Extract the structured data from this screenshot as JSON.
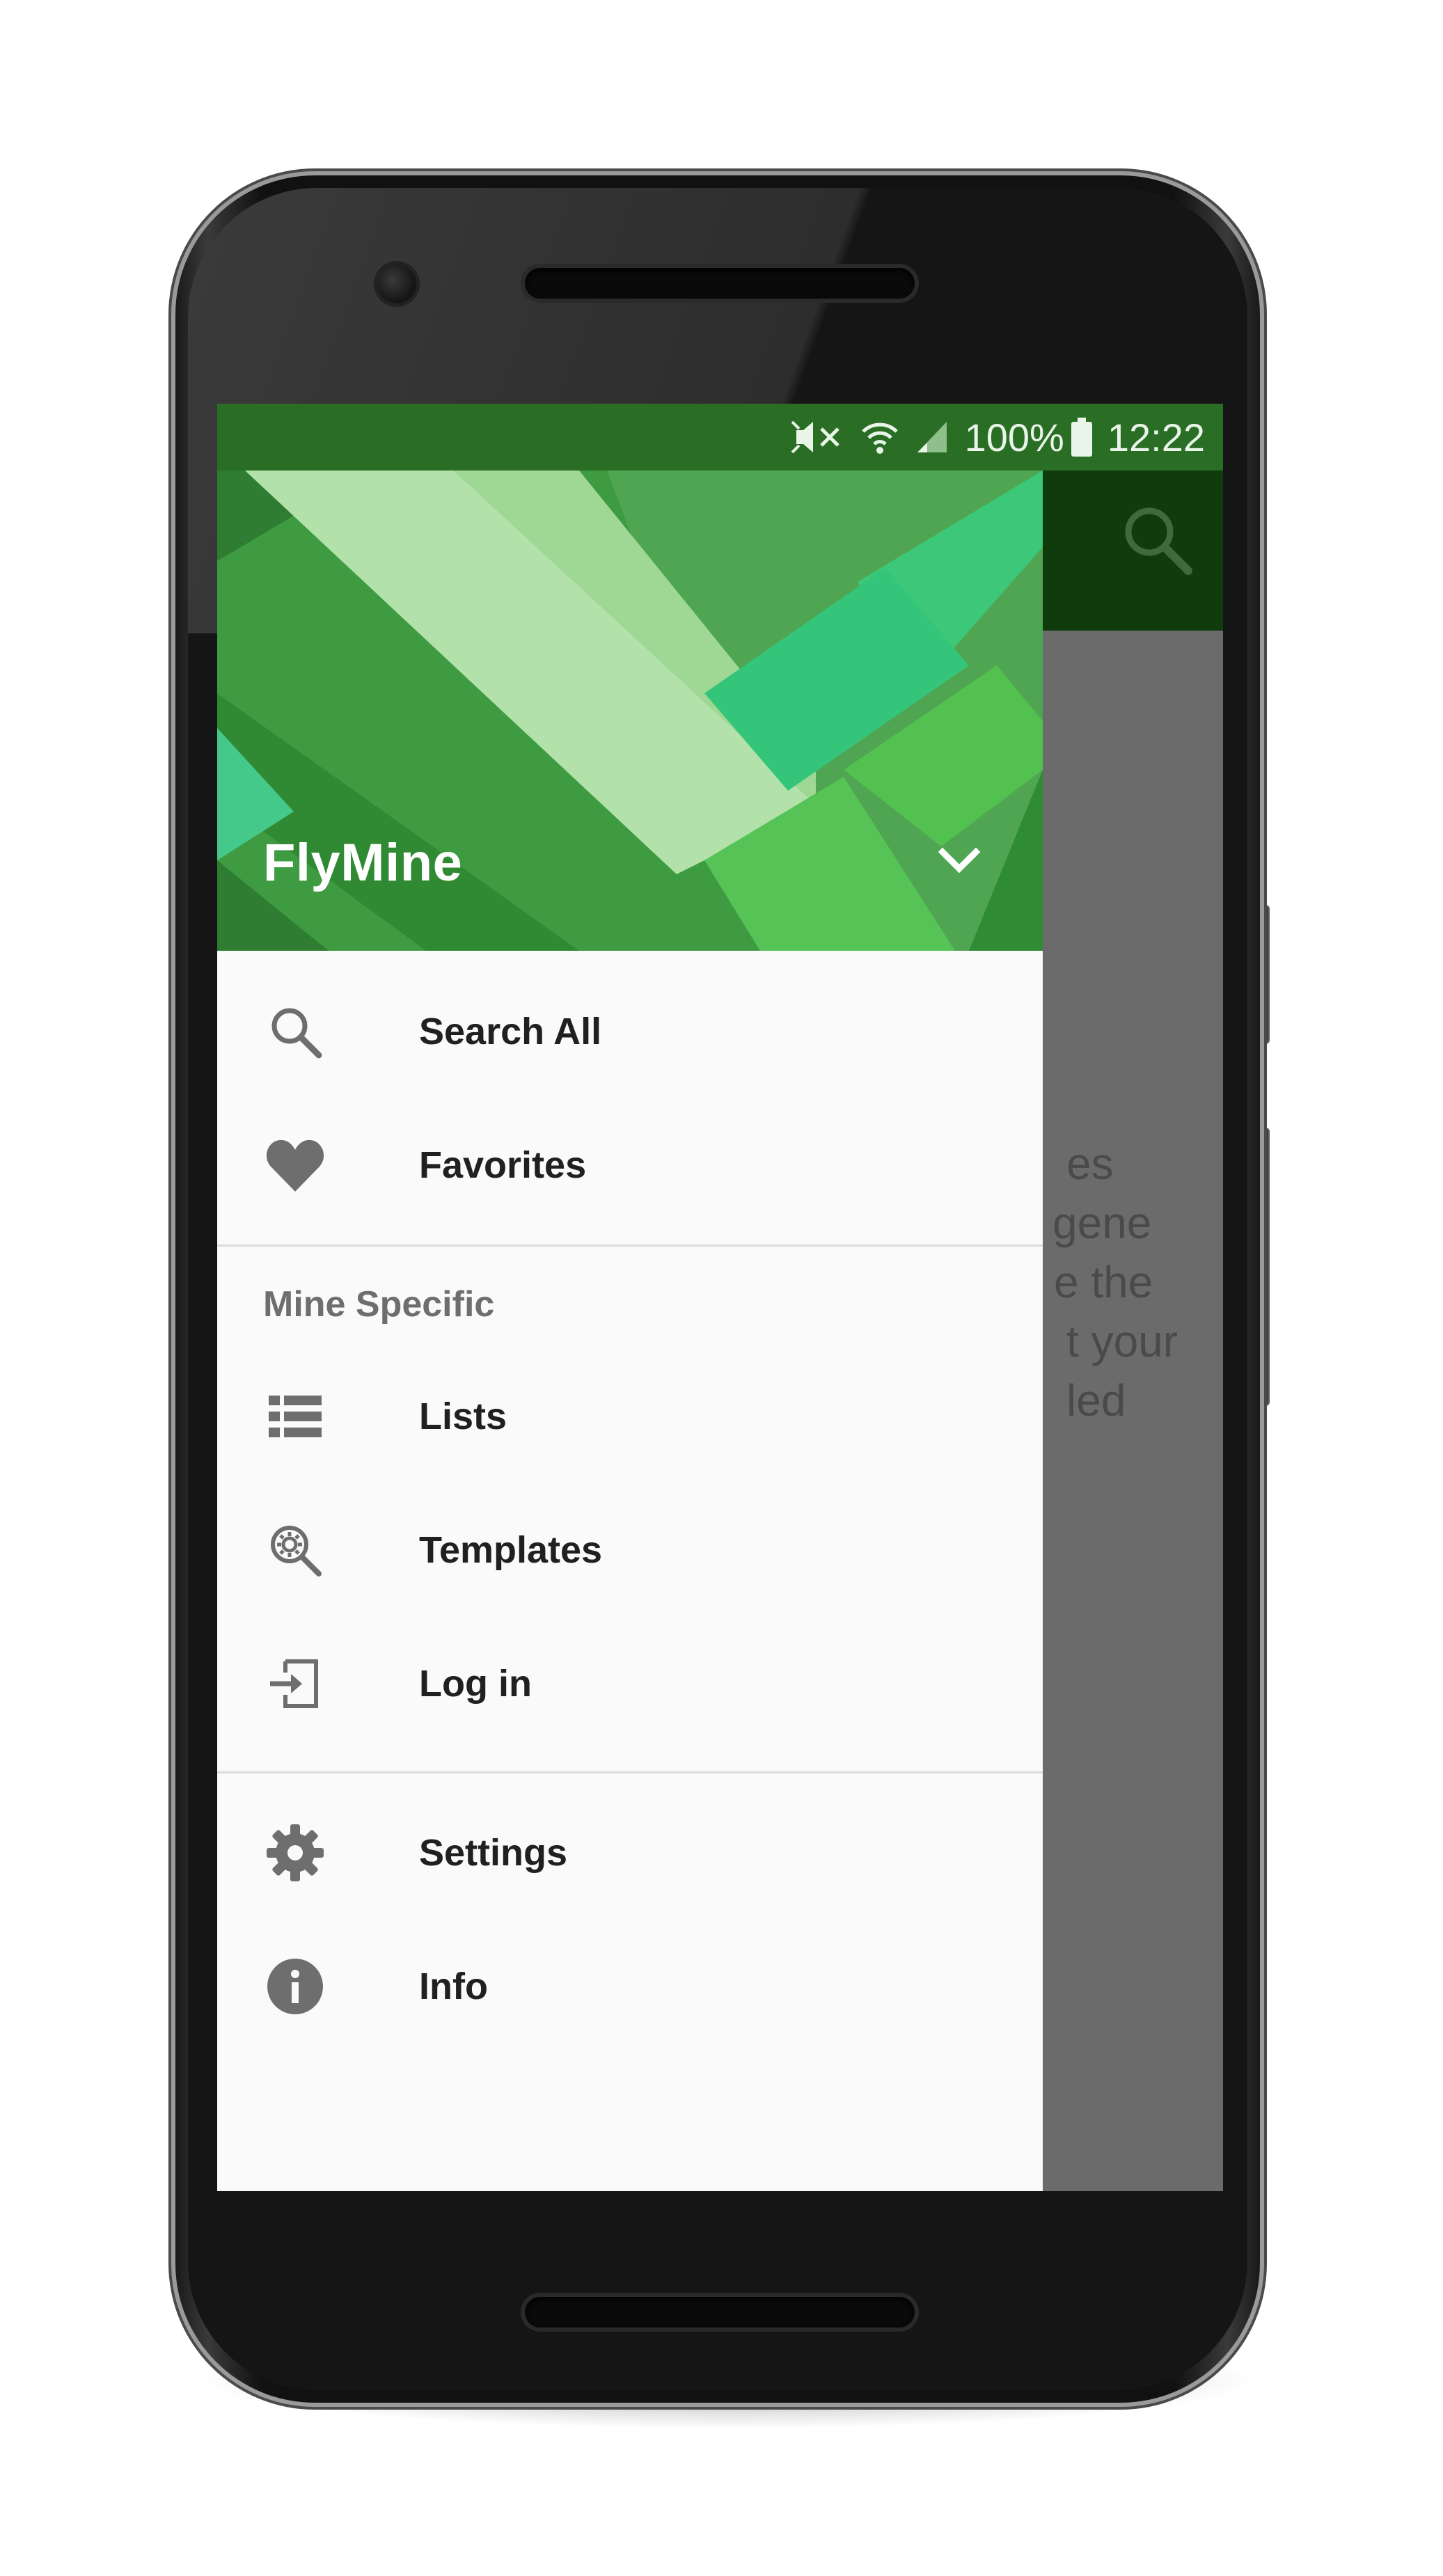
{
  "status_bar": {
    "battery": "100%",
    "time": "12:22",
    "icons": [
      "mute-icon",
      "wifi-icon",
      "signal-icon",
      "battery-icon"
    ]
  },
  "drawer": {
    "mine_name": "FlyMine",
    "primary_items": [
      {
        "label": "Search All",
        "icon": "search-icon"
      },
      {
        "label": "Favorites",
        "icon": "heart-icon"
      }
    ],
    "section_title": "Mine Specific",
    "mine_items": [
      {
        "label": "Lists",
        "icon": "list-icon"
      },
      {
        "label": "Templates",
        "icon": "templates-icon"
      },
      {
        "label": "Log in",
        "icon": "login-icon"
      }
    ],
    "footer_items": [
      {
        "label": "Settings",
        "icon": "gear-icon"
      },
      {
        "label": "Info",
        "icon": "info-icon"
      }
    ]
  },
  "background_content": {
    "text_fragments": [
      "es",
      "gene",
      "e the",
      "t your",
      "led"
    ]
  },
  "colors": {
    "status_bar": "#2a6e25",
    "app_bar": "#0f3b0d",
    "header_green": "#3d9a40",
    "drawer_bg": "#fafafa",
    "scrim": "#6b6b6b"
  }
}
